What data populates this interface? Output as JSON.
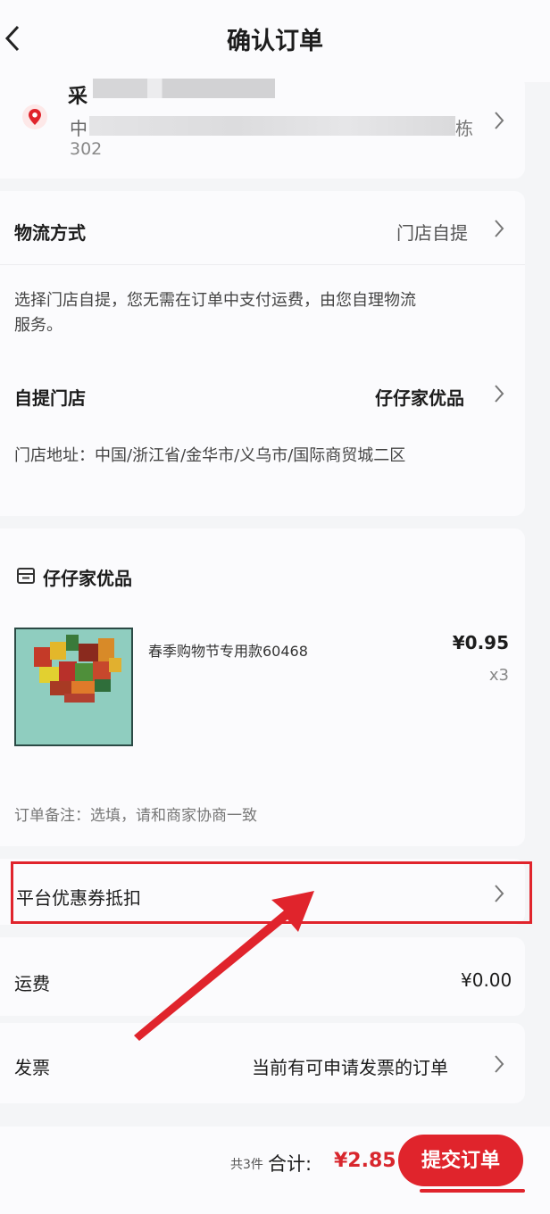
{
  "header": {
    "title": "确认订单"
  },
  "address": {
    "name_prefix": "采",
    "line_prefix": "中",
    "line_suffix": "栋",
    "room": "302"
  },
  "logistics": {
    "method_label": "物流方式",
    "method_value": "门店自提",
    "note": "选择门店自提，您无需在订单中支付运费，由您自理物流服务。",
    "store_label": "自提门店",
    "store_value": "仔仔家优品",
    "store_address": "门店地址：中国/浙江省/金华市/义乌市/国际商贸城二区"
  },
  "goods": {
    "shop_name": "仔仔家优品",
    "item_name": "春季购物节专用款60468",
    "price": "¥0.95",
    "qty": "x3",
    "remark": "订单备注：选填，请和商家协商一致"
  },
  "coupon": {
    "label": "平台优惠券抵扣"
  },
  "freight": {
    "label": "运费",
    "value": "¥0.00"
  },
  "invoice": {
    "label": "发票",
    "value": "当前有可申请发票的订单"
  },
  "footer": {
    "count": "共3件",
    "total_label": "合计:",
    "total_value": "¥2.85",
    "submit_label": "提交订单"
  },
  "colors": {
    "accent": "#e0242c",
    "background": "#f4f5f7"
  },
  "icons": [
    "back-arrow-icon",
    "location-pin-icon",
    "chevron-right-icon",
    "shop-icon"
  ]
}
